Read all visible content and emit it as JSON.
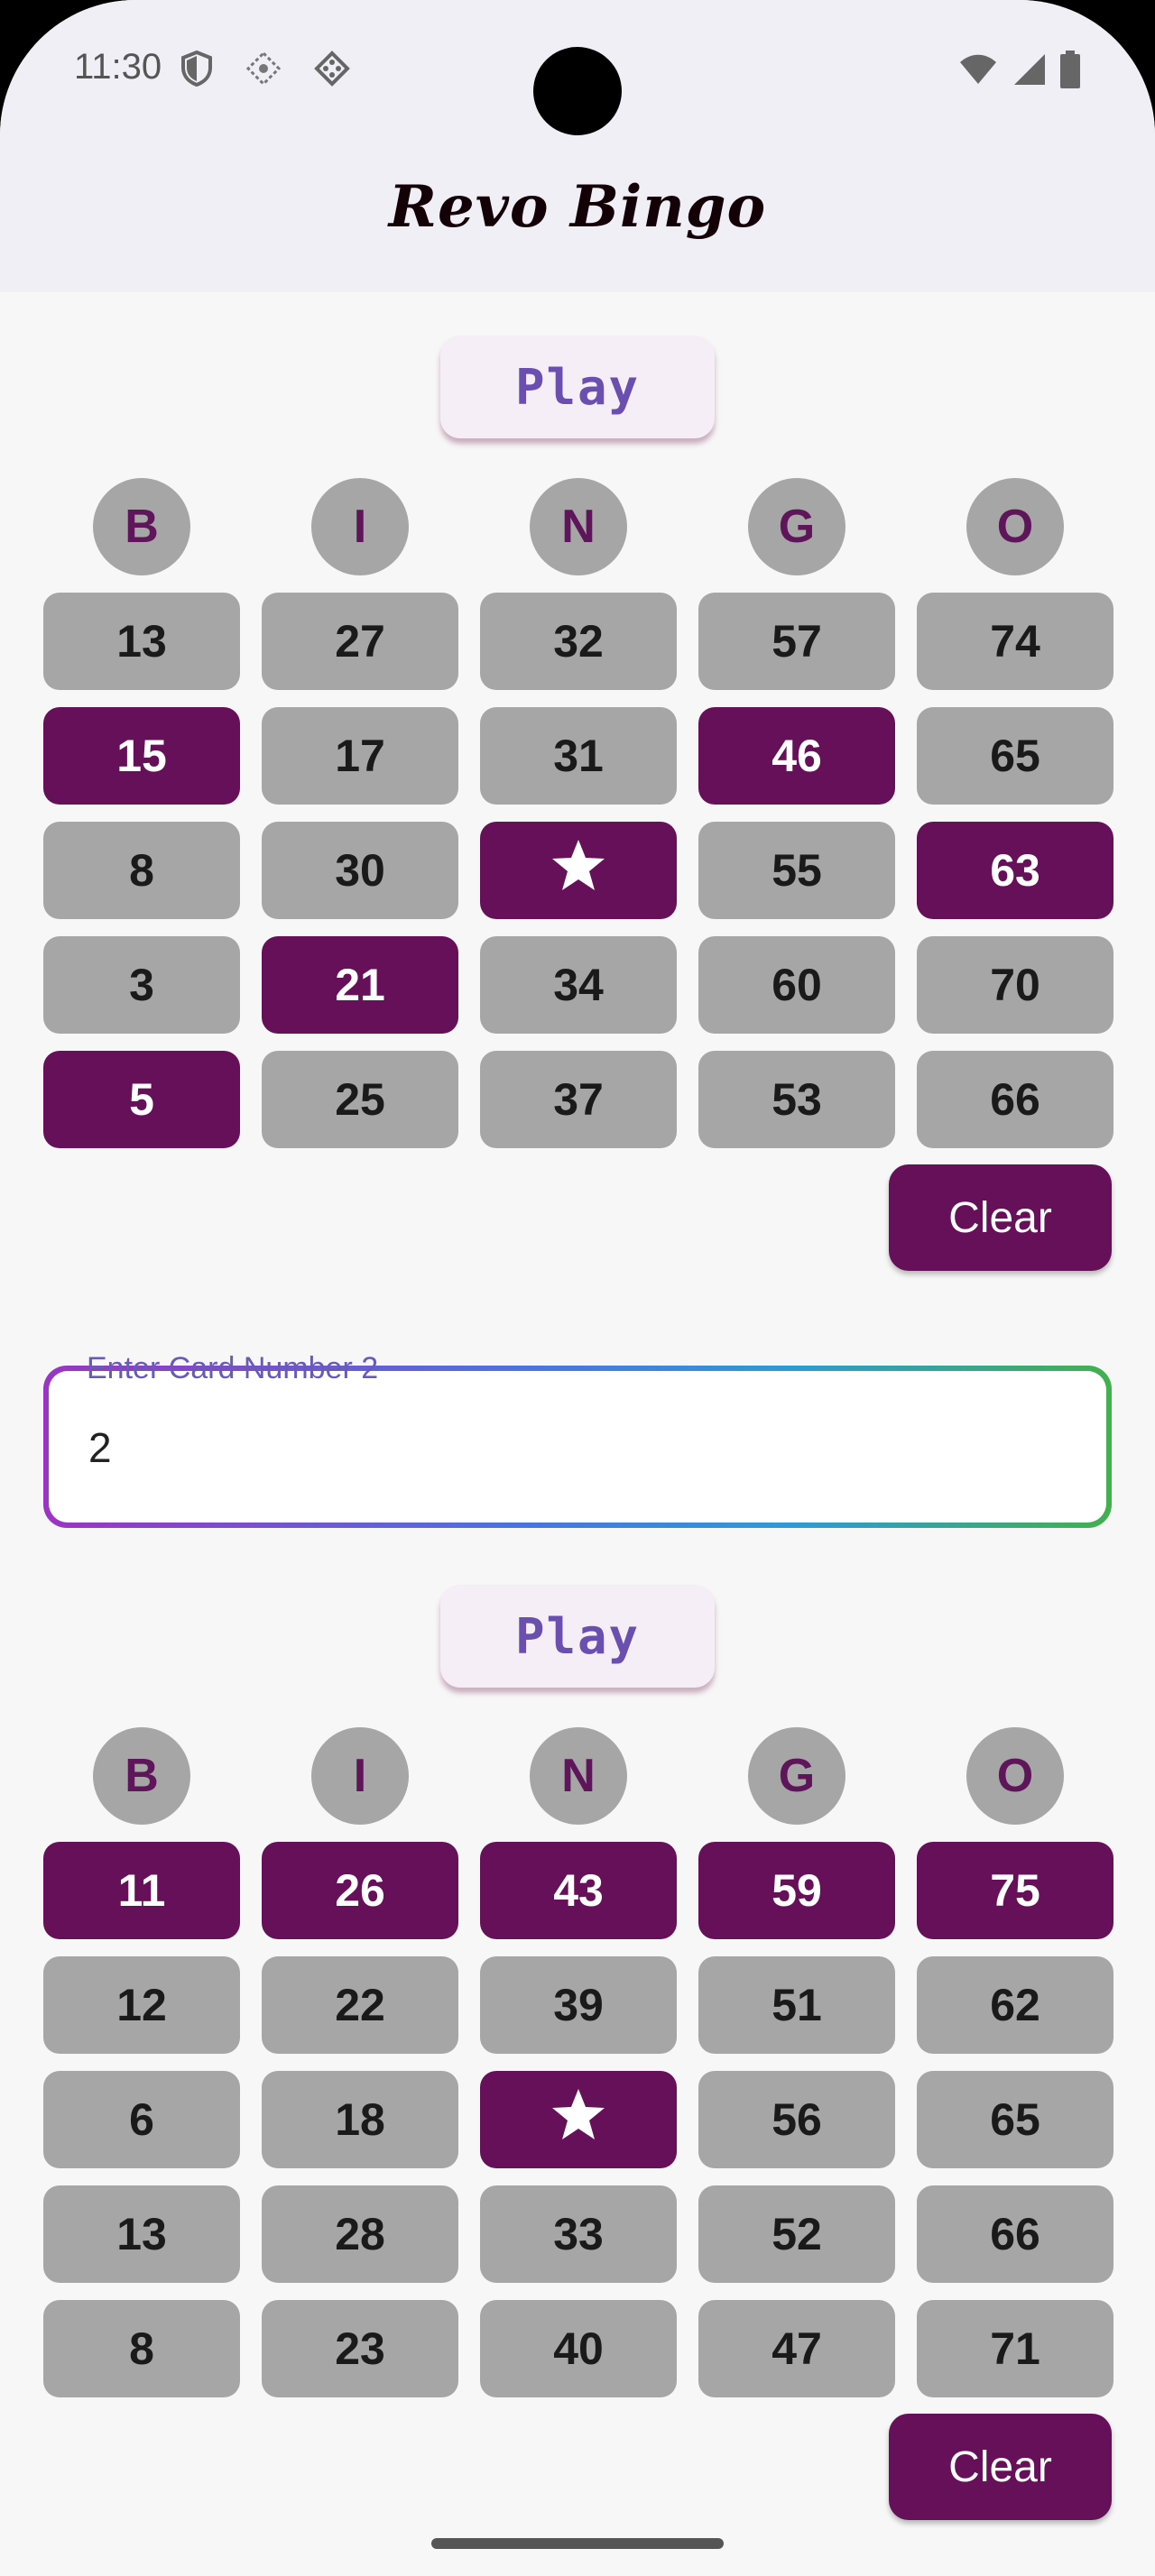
{
  "status_bar": {
    "time": "11:30"
  },
  "app": {
    "title": "Revo Bingo"
  },
  "headers": [
    "B",
    "I",
    "N",
    "G",
    "O"
  ],
  "card1": {
    "play_label": "Play",
    "clear_label": "Clear",
    "rows": [
      [
        {
          "v": "13",
          "m": false
        },
        {
          "v": "27",
          "m": false
        },
        {
          "v": "32",
          "m": false
        },
        {
          "v": "57",
          "m": false
        },
        {
          "v": "74",
          "m": false
        }
      ],
      [
        {
          "v": "15",
          "m": true
        },
        {
          "v": "17",
          "m": false
        },
        {
          "v": "31",
          "m": false
        },
        {
          "v": "46",
          "m": true
        },
        {
          "v": "65",
          "m": false
        }
      ],
      [
        {
          "v": "8",
          "m": false
        },
        {
          "v": "30",
          "m": false
        },
        {
          "v": "★",
          "m": true
        },
        {
          "v": "55",
          "m": false
        },
        {
          "v": "63",
          "m": true
        }
      ],
      [
        {
          "v": "3",
          "m": false
        },
        {
          "v": "21",
          "m": true
        },
        {
          "v": "34",
          "m": false
        },
        {
          "v": "60",
          "m": false
        },
        {
          "v": "70",
          "m": false
        }
      ],
      [
        {
          "v": "5",
          "m": true
        },
        {
          "v": "25",
          "m": false
        },
        {
          "v": "37",
          "m": false
        },
        {
          "v": "53",
          "m": false
        },
        {
          "v": "66",
          "m": false
        }
      ]
    ]
  },
  "card_input": {
    "label": "Enter Card Number 2",
    "value": "2"
  },
  "card2": {
    "play_label": "Play",
    "clear_label": "Clear",
    "rows": [
      [
        {
          "v": "11",
          "m": true
        },
        {
          "v": "26",
          "m": true
        },
        {
          "v": "43",
          "m": true
        },
        {
          "v": "59",
          "m": true
        },
        {
          "v": "75",
          "m": true
        }
      ],
      [
        {
          "v": "12",
          "m": false
        },
        {
          "v": "22",
          "m": false
        },
        {
          "v": "39",
          "m": false
        },
        {
          "v": "51",
          "m": false
        },
        {
          "v": "62",
          "m": false
        }
      ],
      [
        {
          "v": "6",
          "m": false
        },
        {
          "v": "18",
          "m": false
        },
        {
          "v": "★",
          "m": true
        },
        {
          "v": "56",
          "m": false
        },
        {
          "v": "65",
          "m": false
        }
      ],
      [
        {
          "v": "13",
          "m": false
        },
        {
          "v": "28",
          "m": false
        },
        {
          "v": "33",
          "m": false
        },
        {
          "v": "52",
          "m": false
        },
        {
          "v": "66",
          "m": false
        }
      ],
      [
        {
          "v": "8",
          "m": false
        },
        {
          "v": "23",
          "m": false
        },
        {
          "v": "40",
          "m": false
        },
        {
          "v": "47",
          "m": false
        },
        {
          "v": "71",
          "m": false
        }
      ]
    ]
  },
  "colors": {
    "marked": "#66105a",
    "unmarked": "#a6a6a6",
    "header_text": "#5e1559"
  }
}
